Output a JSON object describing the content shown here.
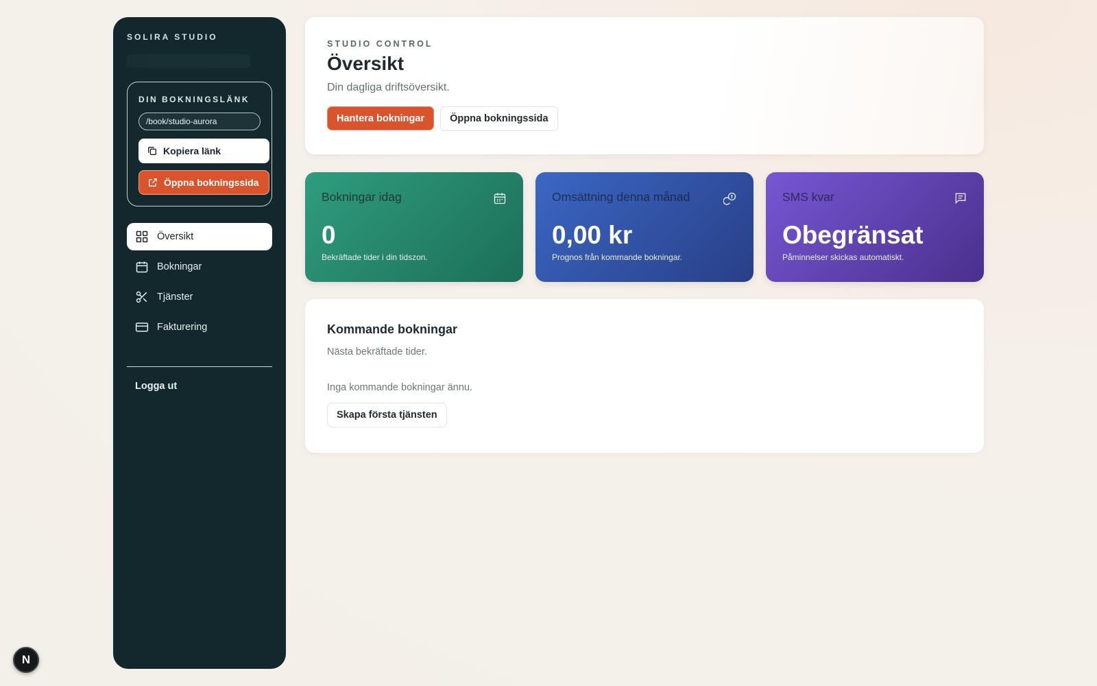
{
  "sidebar": {
    "brand": "SOLIRA STUDIO",
    "link_card": {
      "heading": "DIN BOKNINGSLÄNK",
      "url_value": "/book/studio-aurora",
      "copy_label": "Kopiera länk",
      "open_label": "Öppna bokningssida"
    },
    "nav": [
      {
        "label": "Översikt",
        "icon": "grid-icon",
        "active": true
      },
      {
        "label": "Bokningar",
        "icon": "calendar-icon"
      },
      {
        "label": "Tjänster",
        "icon": "scissors-icon"
      },
      {
        "label": "Fakturering",
        "icon": "credit-card-icon"
      }
    ],
    "logout_label": "Logga ut"
  },
  "header": {
    "eyebrow": "STUDIO CONTROL",
    "title": "Översikt",
    "subtitle": "Din dagliga driftsöversikt.",
    "primary_btn": "Hantera bokningar",
    "secondary_btn": "Öppna bokningssida"
  },
  "stats": [
    {
      "label": "Bokningar idag",
      "value": "0",
      "note": "Bekräftade tider i din tidszon.",
      "icon": "calendar-icon",
      "color": "#2f9d7f"
    },
    {
      "label": "Omsättning denna månad",
      "value": "0,00 kr",
      "note": "Prognos från kommande bokningar.",
      "icon": "coins-icon",
      "color": "#3b67c4"
    },
    {
      "label": "SMS kvar",
      "value": "Obegränsat",
      "note": "Påminnelser skickas automatiskt.",
      "icon": "message-icon",
      "color": "#7757d4"
    }
  ],
  "upcoming": {
    "title": "Kommande bokningar",
    "subtitle": "Nästa bekräftade tider.",
    "empty_text": "Inga kommande bokningar ännu.",
    "create_btn": "Skapa första tjänsten"
  },
  "badge": {
    "letter": "N"
  },
  "colors": {
    "accent": "#d9542d",
    "sidebar_bg": "#12282c"
  }
}
